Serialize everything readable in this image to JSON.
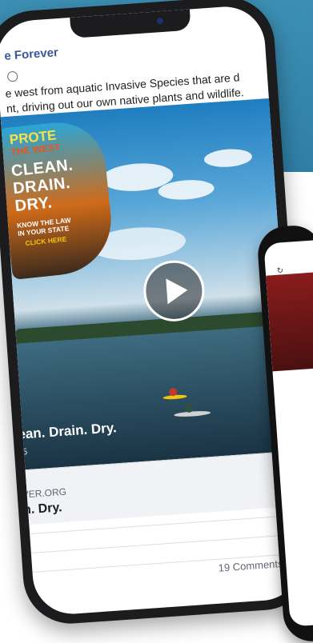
{
  "page": {
    "name": "e Forever",
    "post_text_line1": "e west from aquatic Invasive Species that are d",
    "post_text_line2": "nt, driving out our own native plants and wildlife."
  },
  "video": {
    "badge_title": "PROTE",
    "badge_sub": "THE WEST",
    "badge_clean": "CLEAN.",
    "badge_drain": "DRAIN.",
    "badge_dry": "DRY.",
    "badge_know1": "KNOW THE LAW",
    "badge_know2": "IN YOUR STATE",
    "badge_click": "CLICK HERE",
    "title": "ean. Drain. Dry.",
    "subtitle": "5"
  },
  "link": {
    "domain": "VER.ORG",
    "title": "n. Dry."
  },
  "footer": {
    "comments": "19 Comments"
  },
  "colors": {
    "background_band": "#3c8fb4",
    "page_name": "#385898",
    "phone_frame": "#1c1c1e"
  },
  "icons": [
    "globe-icon",
    "play-icon",
    "reload-icon"
  ]
}
